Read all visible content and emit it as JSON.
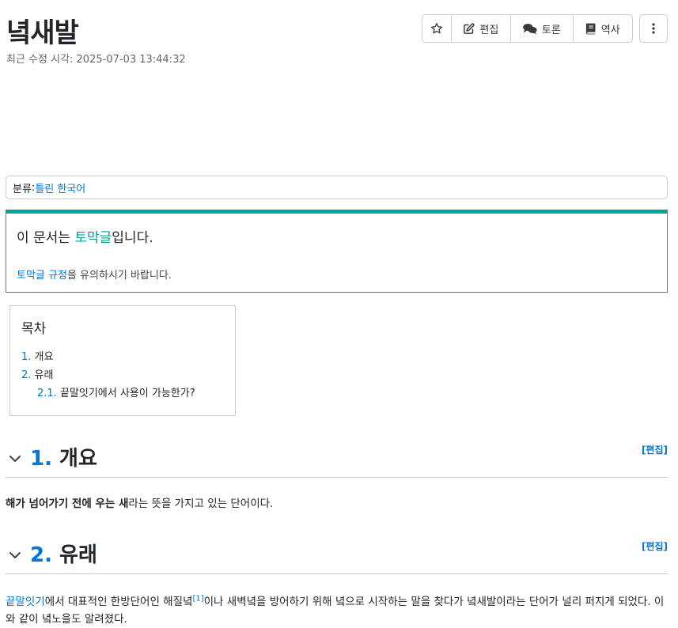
{
  "page": {
    "title": "녘새발",
    "modified_label": "최근 수정 시각: 2025-07-03 13:44:32"
  },
  "toolbar": {
    "star_icon": "star-icon",
    "edit_label": "편집",
    "discuss_label": "토론",
    "history_label": "역사",
    "more_icon": "more-vertical-icon"
  },
  "category": {
    "label": "분류",
    "colon": ":",
    "link": "틀린 한국어"
  },
  "stub_notice": {
    "prefix": "이 문서는 ",
    "link": "토막글",
    "suffix": "입니다.",
    "rule_link": "토막글 규정",
    "rule_suffix": "을 유의하시기 바랍니다."
  },
  "toc": {
    "title": "목차",
    "items": [
      {
        "num": "1.",
        "label": "개요"
      },
      {
        "num": "2.",
        "label": "유래"
      },
      {
        "num": "2.1.",
        "label": "끝말잇기에서 사용이 가능한가?"
      }
    ]
  },
  "sections": [
    {
      "num": "1.",
      "title": "개요",
      "edit_label": "[편집]",
      "body_bold": "해가 넘어가기 전에 우는 새",
      "body_rest": "라는 뜻을 가지고 있는 단어이다."
    },
    {
      "num": "2.",
      "title": "유래",
      "edit_label": "[편집]",
      "body_link": "끝말잇기",
      "body_part1": "에서 대표적인 한방단어인 해질녘",
      "footnote": "[1]",
      "body_part2": "이나 새벽녘을 방어하기 위해 녘으로 시작하는 말을 찾다가 녘새발이라는 단어가 널리 퍼지게 되었다. 이와 같이 녘노을도 알려졌다."
    }
  ],
  "colors": {
    "accent": "#00a495",
    "link": "#0275d8"
  }
}
